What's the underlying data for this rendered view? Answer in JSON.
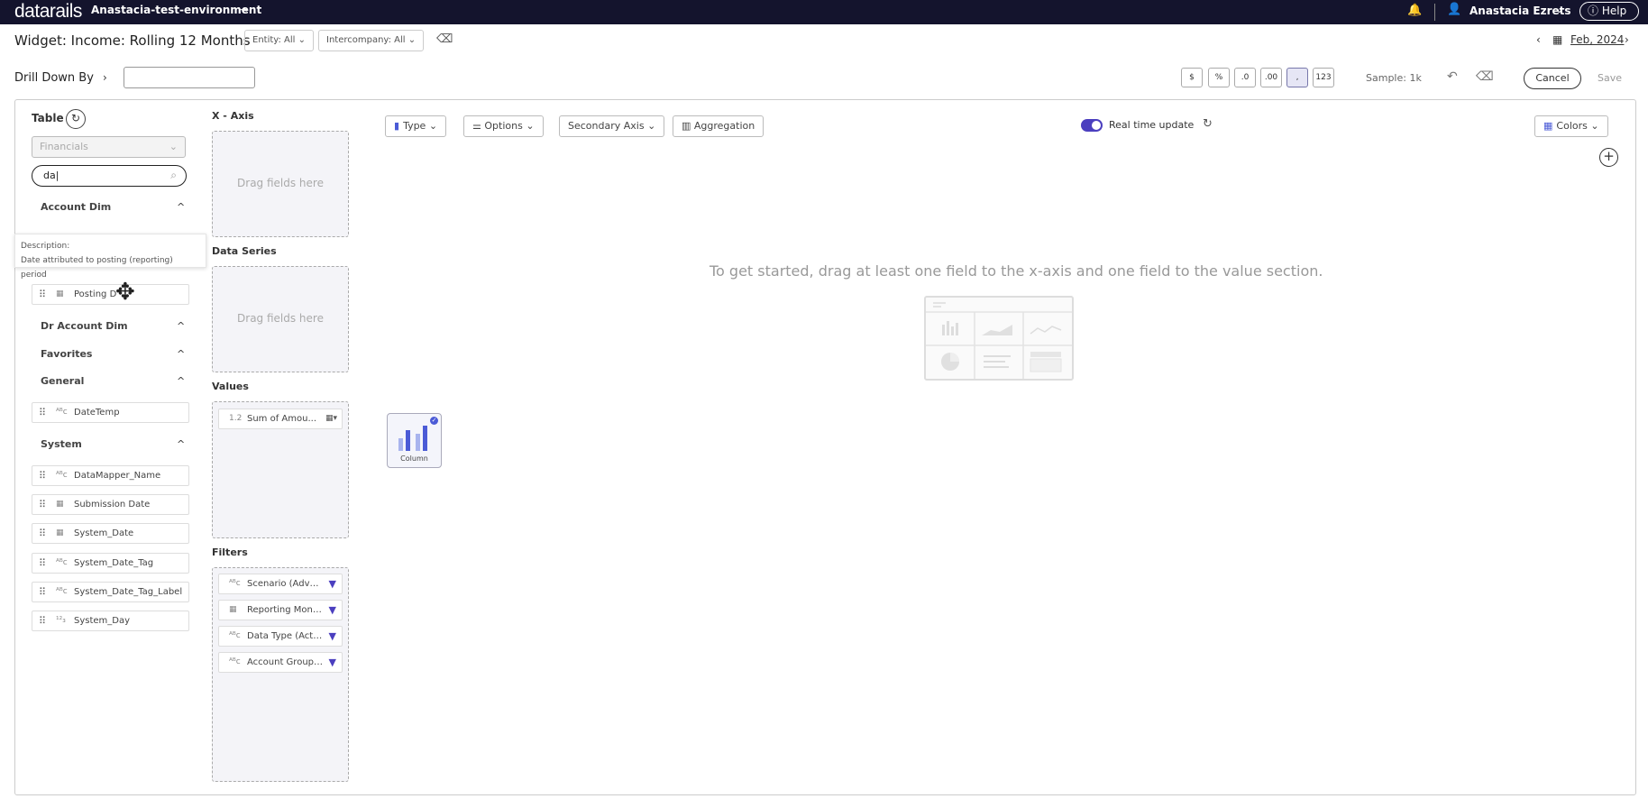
{
  "topbar": {
    "logo": "datarails",
    "environment": "Anastacia-test-environment",
    "user_name": "Anastacia Ezrets",
    "help_label": "Help"
  },
  "header": {
    "widget_title": "Widget: Income: Rolling 12 Months",
    "entity_filter": "Entity: All",
    "intercompany_filter": "Intercompany: All",
    "period": "Feb, 2024"
  },
  "drill": {
    "label": "Drill Down By",
    "input_value": ""
  },
  "format_buttons": [
    "$",
    "%",
    ".0",
    ".00",
    ",",
    "123"
  ],
  "sample_label": "Sample: 1k",
  "actions": {
    "cancel": "Cancel",
    "save": "Save"
  },
  "left_panel": {
    "table_label": "Table",
    "table_select": "Financials",
    "search_value": "da",
    "tooltip_title": "Description:",
    "tooltip_text": "Date attributed to posting (reporting) period",
    "groups": {
      "account_dim": "Account Dim",
      "dr_account_dim": "Dr Account Dim",
      "favorites": "Favorites",
      "general": "General",
      "system": "System"
    },
    "fields": {
      "posting_date": "Posting D",
      "datetemp": "DateTemp",
      "datamapper_name": "DataMapper_Name",
      "submission_date": "Submission Date",
      "system_date": "System_Date",
      "system_date_tag": "System_Date_Tag",
      "system_date_tag_label": "System_Date_Tag_Label",
      "system_day": "System_Day"
    }
  },
  "zones": {
    "x_axis": "X - Axis",
    "data_series": "Data Series",
    "values": "Values",
    "filters": "Filters",
    "drop_hint": "Drag fields here",
    "value_items": [
      "Sum of Amou..."
    ],
    "filter_items": [
      "Scenario (Adva...",
      "Reporting Mont...",
      "Data Type (Acti...",
      "Account Group ..."
    ]
  },
  "chart_toolbar": {
    "type": "Type",
    "options": "Options",
    "secondary_axis": "Secondary Axis",
    "aggregation": "Aggregation",
    "realtime": "Real time update",
    "colors": "Colors"
  },
  "canvas": {
    "empty_message": "To get started, drag at least one field to the x-axis and one field to the value section.",
    "chart_type_card": "Column"
  },
  "colors": {
    "topbar": "#14142d",
    "accent": "#4b3fbf"
  }
}
